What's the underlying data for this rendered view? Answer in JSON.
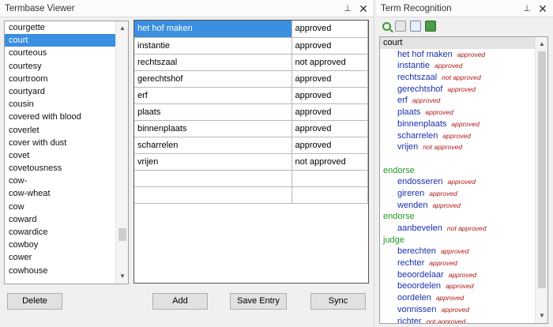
{
  "termbase": {
    "title": "Termbase Viewer",
    "pin_glyph": "⊥",
    "close_glyph": "✕",
    "words": [
      "courgette",
      "court",
      "courteous",
      "courtesy",
      "courtroom",
      "courtyard",
      "cousin",
      "covered with blood",
      "coverlet",
      "cover with dust",
      "covet",
      "covetousness",
      "cow-",
      "cow-wheat",
      "cow",
      "coward",
      "cowardice",
      "cowboy",
      "cower",
      "cowhouse"
    ],
    "selected_word": "court",
    "translations": [
      {
        "term": "het hof maken",
        "status": "approved"
      },
      {
        "term": "instantie",
        "status": "approved"
      },
      {
        "term": "rechtszaal",
        "status": "not approved"
      },
      {
        "term": "gerechtshof",
        "status": "approved"
      },
      {
        "term": "erf",
        "status": "approved"
      },
      {
        "term": "plaats",
        "status": "approved"
      },
      {
        "term": "binnenplaats",
        "status": "approved"
      },
      {
        "term": "scharrelen",
        "status": "approved"
      },
      {
        "term": "vrijen",
        "status": "not approved"
      },
      {
        "term": "",
        "status": ""
      },
      {
        "term": "",
        "status": ""
      }
    ],
    "buttons": {
      "delete": "Delete",
      "add": "Add",
      "save": "Save Entry",
      "sync": "Sync"
    }
  },
  "recognition": {
    "title": "Term Recognition",
    "pin_glyph": "⊥",
    "close_glyph": "✕",
    "toolbar_icons": [
      "search-icon",
      "refresh-icon",
      "filter-icon",
      "export-icon"
    ],
    "groups": [
      {
        "term": "court",
        "translations": [
          {
            "term": "het hof maken",
            "status": "approved"
          },
          {
            "term": "instantie",
            "status": "approved"
          },
          {
            "term": "rechtszaal",
            "status": "not approved"
          },
          {
            "term": "gerechtshof",
            "status": "approved"
          },
          {
            "term": "erf",
            "status": "approved"
          },
          {
            "term": "plaats",
            "status": "approved"
          },
          {
            "term": "binnenplaats",
            "status": "approved"
          },
          {
            "term": "scharrelen",
            "status": "approved"
          },
          {
            "term": "vrijen",
            "status": "not approved"
          }
        ]
      },
      {
        "term": "endorse",
        "translations": [
          {
            "term": "endosseren",
            "status": "approved"
          },
          {
            "term": "gireren",
            "status": "approved"
          },
          {
            "term": "wenden",
            "status": "approved"
          }
        ]
      },
      {
        "term": "endorse",
        "translations": [
          {
            "term": "aanbevelen",
            "status": "not approved"
          }
        ]
      },
      {
        "term": "judge",
        "translations": [
          {
            "term": "berechten",
            "status": "approved"
          },
          {
            "term": "rechter",
            "status": "approved"
          },
          {
            "term": "beoordelaar",
            "status": "approved"
          },
          {
            "term": "beoordelen",
            "status": "approved"
          },
          {
            "term": "oordelen",
            "status": "approved"
          },
          {
            "term": "vonnissen",
            "status": "approved"
          },
          {
            "term": "richter",
            "status": "not approved"
          }
        ]
      }
    ]
  },
  "colors": {
    "selection": "#3b8fe0",
    "term_blue": "#1a2fb0",
    "term_green": "#1f9a1f",
    "status_red": "#b01818"
  }
}
